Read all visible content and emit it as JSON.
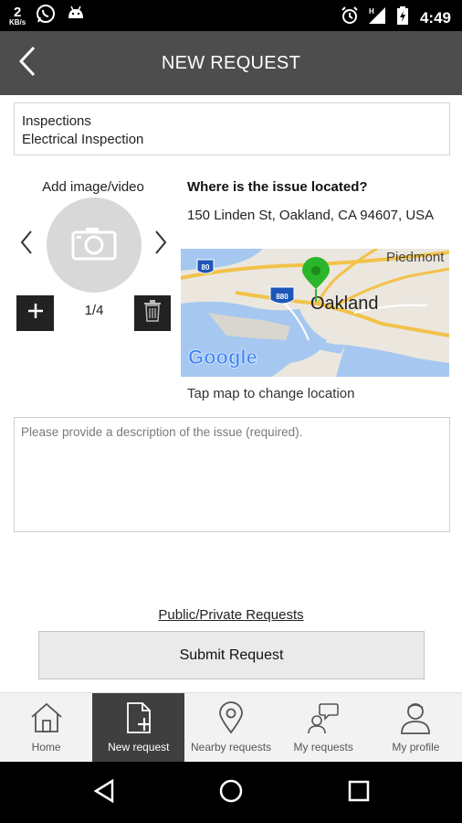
{
  "status_bar": {
    "net_speed_value": "2",
    "net_speed_unit": "KB/s",
    "time": "4:49",
    "icons": [
      "whatsapp-icon",
      "android-icon",
      "alarm-icon",
      "signal-h-icon",
      "battery-charging-icon"
    ]
  },
  "header": {
    "title": "NEW REQUEST",
    "back_icon": "chevron-left-icon"
  },
  "category": {
    "line1": "Inspections",
    "line2": "Electrical Inspection"
  },
  "media": {
    "label": "Add image/video",
    "counter": "1/4",
    "icons": [
      "camera-icon",
      "chevron-left-icon",
      "chevron-right-icon",
      "plus-icon",
      "trash-icon"
    ]
  },
  "location": {
    "heading": "Where is the issue located?",
    "address": "150 Linden St, Oakland, CA 94607, USA",
    "map_hint": "Tap map to change location",
    "map": {
      "city_label": "Oakland",
      "area_label": "Piedmont",
      "shield_80": "80",
      "shield_880": "880",
      "logo_text": "Google"
    }
  },
  "description": {
    "placeholder": "Please provide a description of the issue (required).",
    "value": ""
  },
  "privacy_link": "Public/Private Requests",
  "submit_label": "Submit Request",
  "tabs": [
    {
      "label": "Home",
      "icon": "home-icon",
      "active": false
    },
    {
      "label": "New request",
      "icon": "new-document-icon",
      "active": true
    },
    {
      "label": "Nearby requests",
      "icon": "location-pin-icon",
      "active": false
    },
    {
      "label": "My requests",
      "icon": "person-chat-icon",
      "active": false
    },
    {
      "label": "My profile",
      "icon": "person-icon",
      "active": false
    }
  ],
  "nav": [
    "back-triangle-icon",
    "home-circle-icon",
    "recents-square-icon"
  ],
  "colors": {
    "header_bg": "#4d4d4d",
    "active_tab_bg": "#3f3f3f",
    "map_pin": "#2bb52b"
  }
}
